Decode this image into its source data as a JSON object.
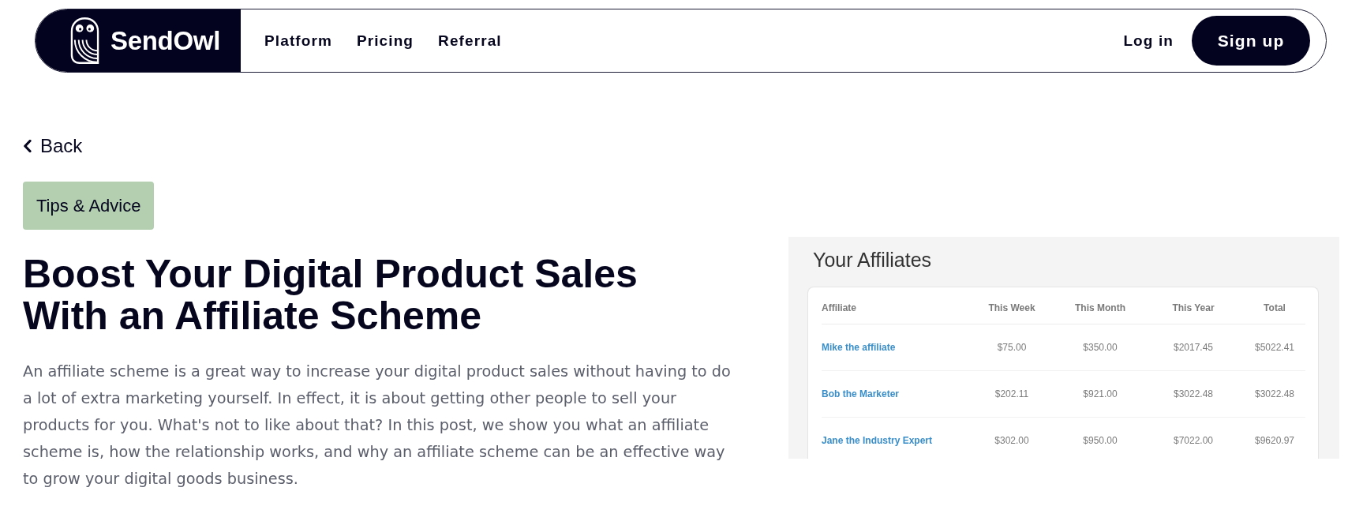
{
  "header": {
    "logo": "SendOwl",
    "nav": [
      "Platform",
      "Pricing",
      "Referral"
    ],
    "actions": [
      {
        "label": "Log in",
        "kind": "link"
      },
      {
        "label": "Sign up",
        "kind": "button"
      }
    ]
  },
  "article": {
    "back": "Back",
    "category": "Tips & Advice",
    "title": "Boost Your Digital Product Sales With an Affiliate Scheme",
    "intro": "An affiliate scheme is a great way to increase your digital product sales without having to do a lot of extra marketing yourself. In effect, it is about getting other people to sell your products for you. What's not to like about that? In this post, we show you what an affiliate scheme is, how the relationship works, and why an affiliate scheme can be an effective way to grow your digital goods business."
  },
  "affiliates_screenshot": {
    "title": "Your Affiliates",
    "columns": [
      "Affiliate",
      "This Week",
      "This Month",
      "This Year",
      "Total"
    ],
    "rows": [
      [
        "Mike the affiliate",
        "$75.00",
        "$350.00",
        "$2017.45",
        "$5022.41"
      ],
      [
        "Bob the Marketer",
        "$202.11",
        "$921.00",
        "$3022.48",
        "$3022.48"
      ],
      [
        "Jane the Industry Expert",
        "$302.00",
        "$950.00",
        "$7022.00",
        "$9620.97"
      ]
    ]
  }
}
